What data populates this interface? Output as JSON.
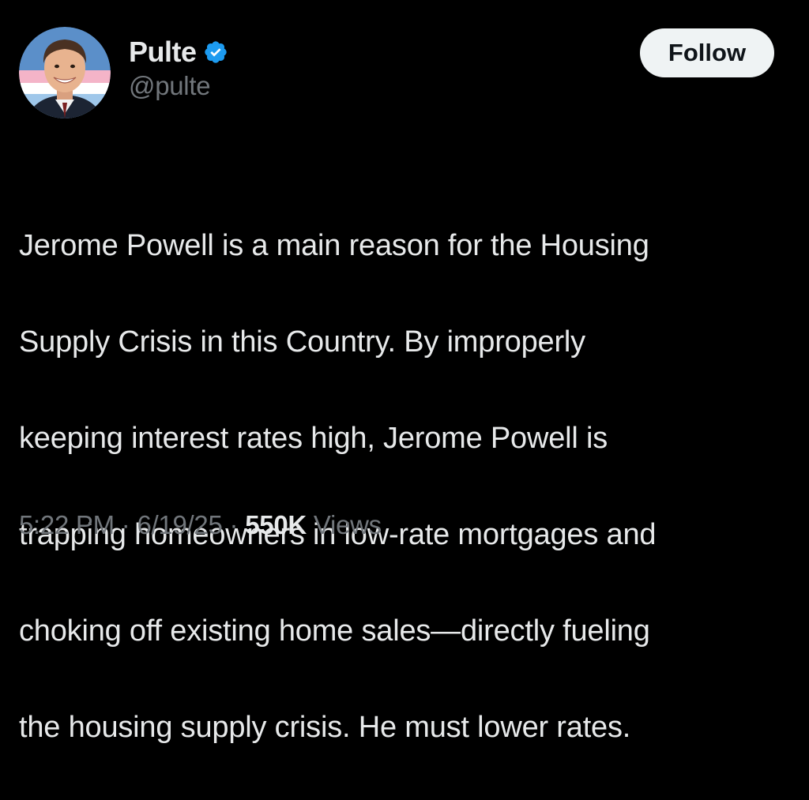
{
  "author": {
    "display_name": "Pulte",
    "handle": "@pulte",
    "verified": true,
    "verified_icon": "verified-badge-icon",
    "avatar": "profile-photo"
  },
  "follow_button": {
    "label": "Follow"
  },
  "tweet": {
    "text_lines": [
      "Jerome Powell is a main reason for the Housing",
      "Supply Crisis in this Country. By improperly",
      "keeping interest rates high, Jerome Powell is",
      "trapping homeowners in low-rate mortgages and",
      "choking off existing home sales—directly fueling",
      "the housing supply crisis. He must lower rates."
    ]
  },
  "meta": {
    "time": "5:22 PM",
    "separator": "·",
    "date": "6/19/25",
    "views_count": "550K",
    "views_label": "Views"
  },
  "colors": {
    "background": "#000000",
    "primary_text": "#e7e9ea",
    "secondary_text": "#71767b",
    "verified_blue": "#1d9bf0",
    "button_bg": "#eff3f4",
    "button_text": "#0f1419"
  }
}
